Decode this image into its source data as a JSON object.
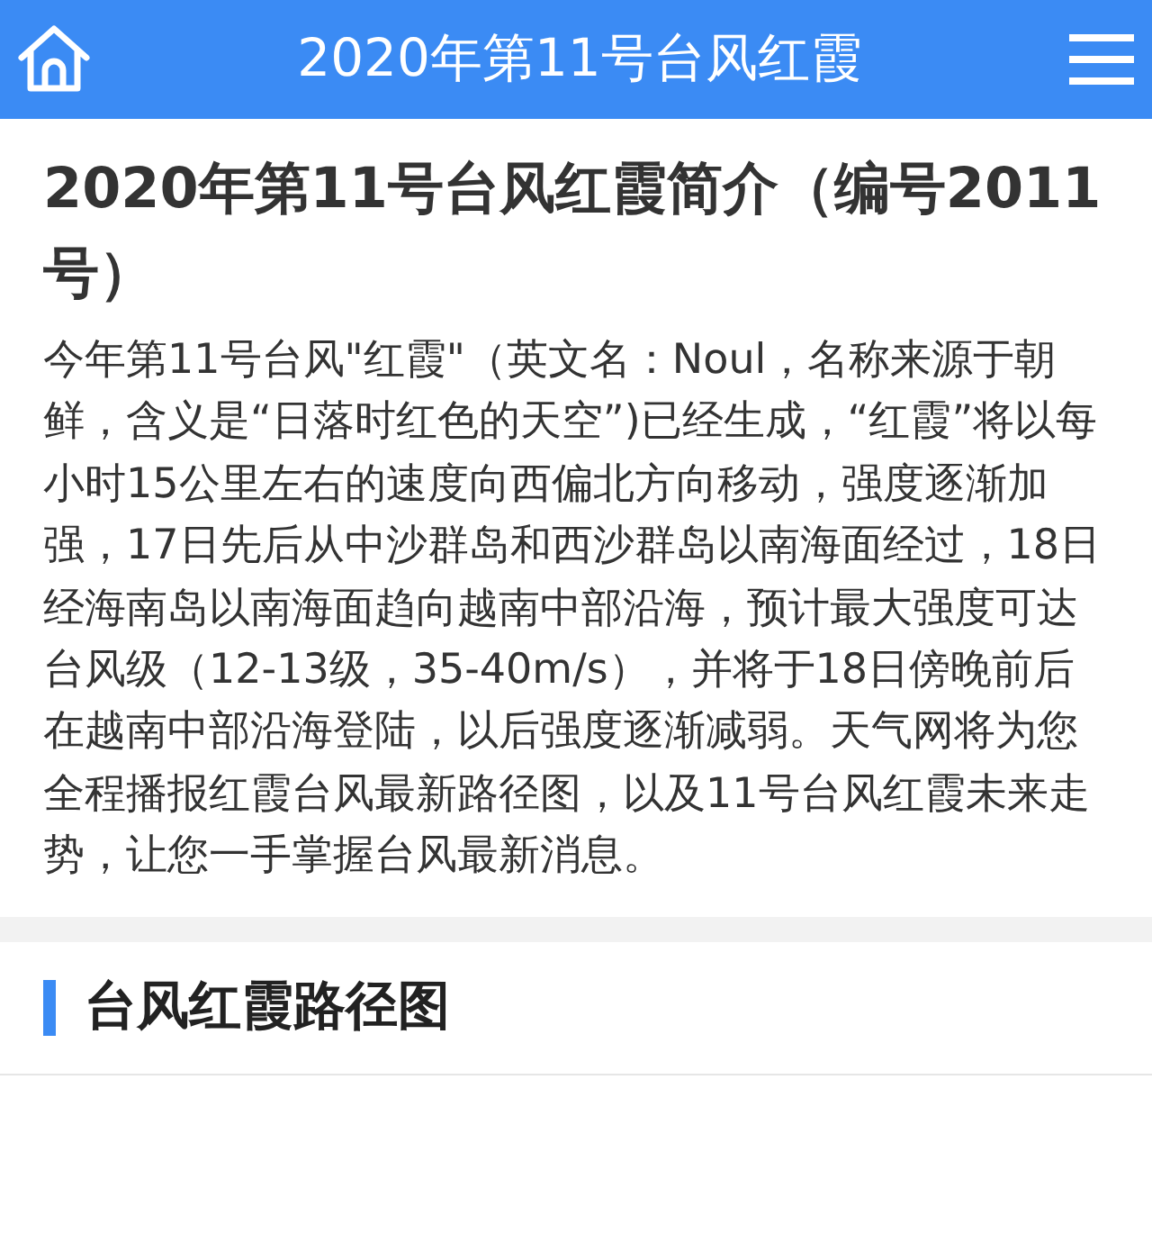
{
  "header": {
    "title": "2020年第11号台风红霞"
  },
  "article": {
    "title": "2020年第11号台风红霞简介（编号2011 号）",
    "body": "今年第11号台风\"红霞\"（英文名：Noul，名称来源于朝鲜，含义是“日落时红色的天空”)已经生成，“红霞”将以每小时15公里左右的速度向西偏北方向移动，强度逐渐加强，17日先后从中沙群岛和西沙群岛以南海面经过，18日经海南岛以南海面趋向越南中部沿海，预计最大强度可达台风级（12-13级，35-40m/s），并将于18日傍晚前后在越南中部沿海登陆，以后强度逐渐减弱。天气网将为您全程播报红霞台风最新路径图，以及11号台风红霞未来走势，让您一手掌握台风最新消息。"
  },
  "section": {
    "title": "台风红霞路径图"
  }
}
